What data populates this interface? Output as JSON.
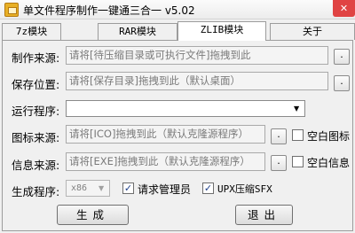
{
  "window": {
    "title": "单文件程序制作一键通三合一 v5.02",
    "close_glyph": "✕",
    "icon": "package-icon"
  },
  "tabs": [
    {
      "label": "7z模块",
      "active": false
    },
    {
      "label": "RAR模块",
      "active": false
    },
    {
      "label": "ZLIB模块",
      "active": true
    },
    {
      "label": "关于",
      "active": false
    }
  ],
  "form": {
    "source": {
      "label": "制作来源:",
      "placeholder": "请将[待压缩目录或可执行文件]拖拽到此",
      "browse_label": "."
    },
    "save": {
      "label": "保存位置:",
      "placeholder": "请将[保存目录]拖拽到此（默认桌面）",
      "browse_label": "."
    },
    "run": {
      "label": "运行程序:",
      "value": ""
    },
    "icon": {
      "label": "图标来源:",
      "placeholder": "请将[ICO]拖拽到此（默认克隆源程序）",
      "browse_label": ".",
      "blank_label": "空白图标",
      "blank_checked": false
    },
    "info": {
      "label": "信息来源:",
      "placeholder": "请将[EXE]拖拽到此（默认克隆源程序）",
      "browse_label": ".",
      "blank_label": "空白信息",
      "blank_checked": false
    },
    "gen": {
      "label": "生成程序:",
      "arch_value": "x86",
      "admin_label": "请求管理员",
      "admin_checked": true,
      "upx_label": "UPX压缩SFX",
      "upx_checked": true
    }
  },
  "buttons": {
    "generate": "生成",
    "exit": "退出"
  },
  "colors": {
    "close_red": "#e04343",
    "app_icon": "#e8b026",
    "check_mark": "#1e3f8a"
  }
}
